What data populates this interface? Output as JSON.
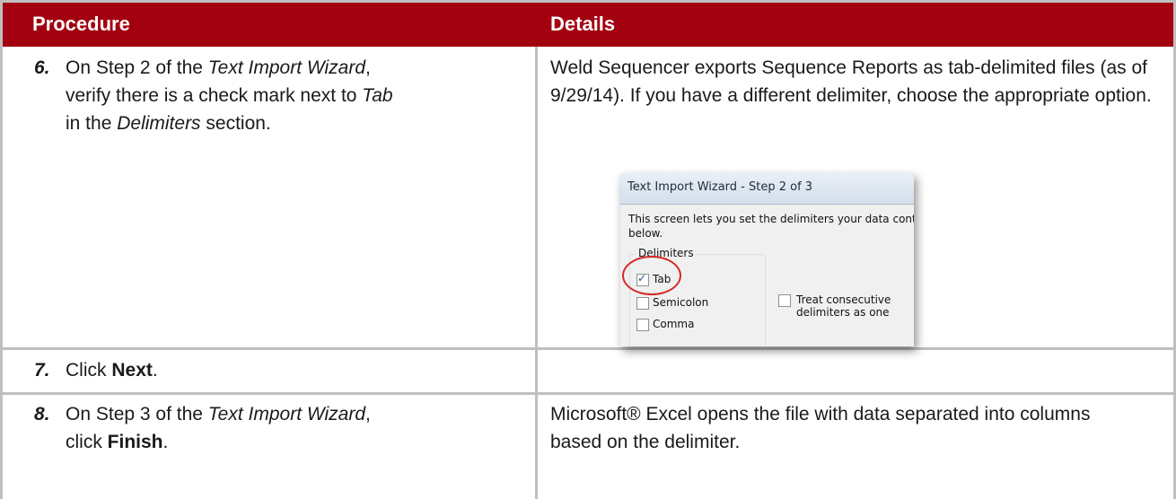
{
  "table": {
    "headers": {
      "procedure": "Procedure",
      "details": "Details"
    },
    "rows": [
      {
        "number": "6.",
        "procedure": {
          "prefix": "On Step 2 of the ",
          "italic1": "Text Import Wizard",
          "mid1": ", verify there is a check mark next to ",
          "italic2": "Tab",
          "mid2": " in the ",
          "italic3": "Delimiters",
          "suffix": " section."
        },
        "details": "Weld Sequencer exports Sequence Reports as tab-delimited files (as of 9/29/14). If you have a different delimiter, choose the appropriate option."
      },
      {
        "number": "7.",
        "procedure": {
          "prefix": "Click ",
          "bold": "Next",
          "suffix": "."
        },
        "details": ""
      },
      {
        "number": "8.",
        "procedure": {
          "prefix": "On Step 3 of the ",
          "italic1": "Text Import Wizard",
          "mid1": ", click ",
          "bold": "Finish",
          "suffix": "."
        },
        "details": "Microsoft® Excel opens the file with data separated into columns based on the delimiter."
      }
    ]
  },
  "dialog_snippet": {
    "title": "Text Import Wizard - Step 2 of 3",
    "description_line1": "This screen lets you set the delimiters your data contains.  You can see h",
    "description_line2": "below.",
    "delimiters_label": "Delimiters",
    "options": [
      {
        "label": "Tab",
        "checked": true
      },
      {
        "label": "Semicolon",
        "checked": false
      },
      {
        "label": "Comma",
        "checked": false
      }
    ],
    "consecutive_label": "Treat consecutive delimiters as one",
    "check_glyph": "✓",
    "highlight_color": "#d62828"
  },
  "colors": {
    "header_bg": "#a30010",
    "grid": "#bfbfbf"
  }
}
